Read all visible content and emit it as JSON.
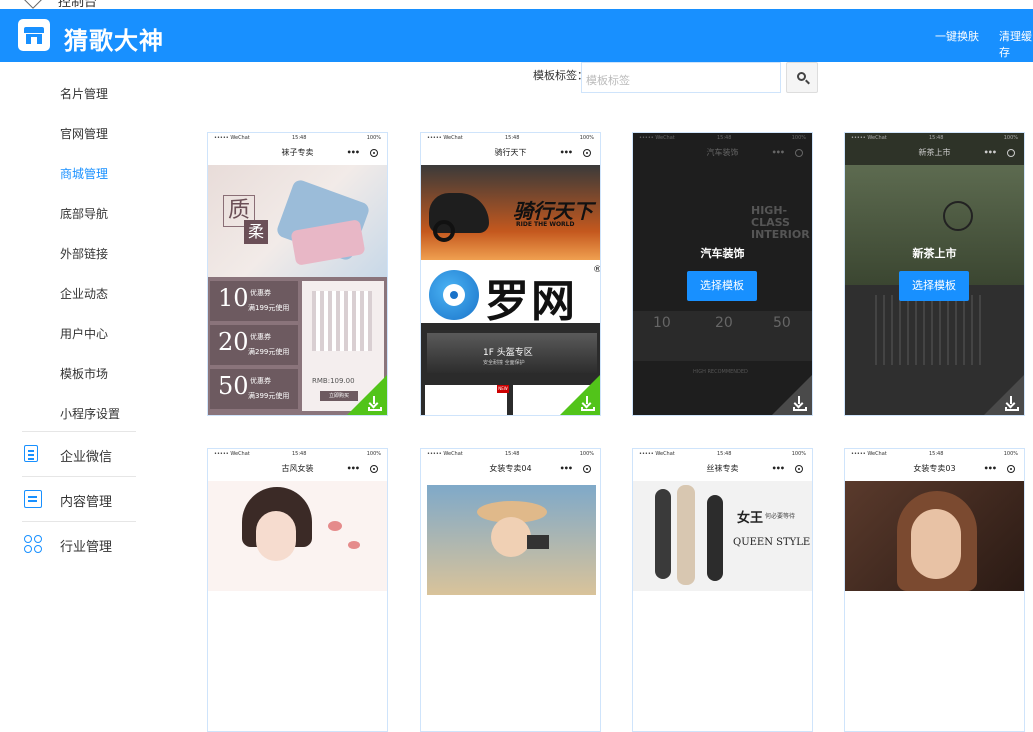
{
  "topbar": {
    "label": "控制台"
  },
  "header": {
    "brand": "猜歌大神",
    "links": [
      {
        "label": "一键换肤"
      },
      {
        "label": "清理缓存"
      }
    ]
  },
  "sidebar": {
    "items": [
      {
        "label": "名片管理"
      },
      {
        "label": "官网管理"
      },
      {
        "label": "商城管理"
      },
      {
        "label": "底部导航"
      },
      {
        "label": "外部链接"
      },
      {
        "label": "企业动态"
      },
      {
        "label": "用户中心"
      },
      {
        "label": "模板市场"
      },
      {
        "label": "小程序设置"
      }
    ],
    "active": "商城管理",
    "groups": [
      {
        "label": "企业微信",
        "icon": "document-icon"
      },
      {
        "label": "内容管理",
        "icon": "calendar-icon"
      },
      {
        "label": "行业管理",
        "icon": "grid-icon"
      }
    ]
  },
  "filter": {
    "label": "模板标签：",
    "placeholder": "模板标签"
  },
  "phone": {
    "carrier": "••••• WeChat",
    "time": "15:48",
    "battery": "100%"
  },
  "templates": [
    {
      "title": "袜子专卖",
      "texts": [
        "质",
        "柔",
        "10",
        "20",
        "50",
        "优惠券",
        "满199元使用",
        "满299元使用",
        "满399元使用",
        "RMB:109.00",
        "立即购买"
      ]
    },
    {
      "title": "骑行天下",
      "texts": [
        "骑行天下",
        "RIDE THE WORLD",
        "1F 头盔专区",
        "安全耐撞 全面保护",
        "NEW"
      ]
    },
    {
      "title": "汽车装饰",
      "overlay": "汽车装饰",
      "button": "选择模板",
      "texts": [
        "HIGH-CLASS INTERIOR",
        "10",
        "20",
        "50",
        "HIGH RECOMMENDED"
      ]
    },
    {
      "title": "新茶上市",
      "overlay": "新茶上市",
      "button": "选择模板"
    },
    {
      "title": "古风女装"
    },
    {
      "title": "女装专卖04"
    },
    {
      "title": "丝袜专卖",
      "texts": [
        "女王",
        "何必要等待",
        "QUEEN STYLE"
      ]
    },
    {
      "title": "女装专卖03"
    }
  ],
  "watermark": {
    "text": "罗网",
    "mark": "®"
  },
  "colors": {
    "primary": "#1890ff",
    "download": "#52c41a"
  }
}
